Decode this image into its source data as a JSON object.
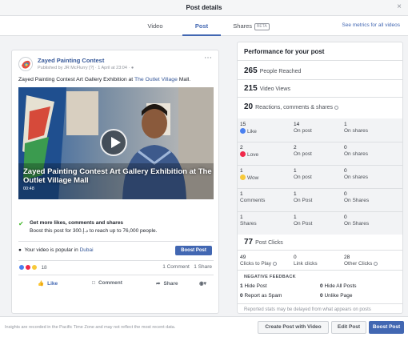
{
  "window": {
    "title": "Post details",
    "close": "×"
  },
  "tabs": [
    {
      "label": "Video"
    },
    {
      "label": "Post"
    },
    {
      "label": "Shares",
      "badge": "BETA"
    }
  ],
  "metrics_link": "See metrics for all videos",
  "post": {
    "page_name": "Zayed Painting Contest",
    "published_by": "Published by JR McFlurry",
    "published_by_badge": "[?]",
    "date": "· 1 April at 23:04 ·",
    "text_before": "Zayed Painting Contest Art Gallery Exhibition at",
    "text_link": "The Outlet Village",
    "text_after": "Mall.",
    "video_caption": "Zayed Painting Contest Art Gallery Exhibition at The Outlet Village Mall",
    "video_time": "00:48",
    "boost_title": "Get more likes, comments and shares",
    "boost_desc": "Boost this post for 300.د.إ to reach up to 76,000 people.",
    "popular_text": "Your video is popular in",
    "popular_link": "Dubai",
    "boost_button": "Boost Post",
    "reaction_count": "18",
    "comments_count": "1 Comment",
    "shares_count": "1 Share",
    "actions": {
      "like": "Like",
      "comment": "Comment",
      "share": "Share"
    }
  },
  "performance": {
    "title": "Performance for your post",
    "people_reached": {
      "value": "265",
      "label": "People Reached"
    },
    "video_views": {
      "value": "215",
      "label": "Video Views"
    },
    "engagement": {
      "value": "20",
      "label": "Reactions, comments & shares"
    },
    "breakdown": [
      {
        "icon": "like",
        "total": "15",
        "label": "Like",
        "on_post": "14",
        "on_post_label": "On post",
        "on_shares": "1",
        "on_shares_label": "On shares"
      },
      {
        "icon": "love",
        "total": "2",
        "label": "Love",
        "on_post": "2",
        "on_post_label": "On post",
        "on_shares": "0",
        "on_shares_label": "On shares"
      },
      {
        "icon": "wow",
        "total": "1",
        "label": "Wow",
        "on_post": "1",
        "on_post_label": "On post",
        "on_shares": "0",
        "on_shares_label": "On shares"
      },
      {
        "icon": "",
        "total": "1",
        "label": "Comments",
        "on_post": "1",
        "on_post_label": "On Post",
        "on_shares": "0",
        "on_shares_label": "On Shares"
      },
      {
        "icon": "",
        "total": "1",
        "label": "Shares",
        "on_post": "1",
        "on_post_label": "On Post",
        "on_shares": "0",
        "on_shares_label": "On Shares"
      }
    ],
    "post_clicks": {
      "value": "77",
      "label": "Post Clicks"
    },
    "click_types": [
      {
        "value": "49",
        "label": "Clicks to Play"
      },
      {
        "value": "0",
        "label": "Link clicks"
      },
      {
        "value": "28",
        "label": "Other Clicks"
      }
    ],
    "negative_title": "NEGATIVE FEEDBACK",
    "negative": [
      {
        "value": "1",
        "label": "Hide Post"
      },
      {
        "value": "0",
        "label": "Hide All Posts"
      },
      {
        "value": "0",
        "label": "Report as Spam"
      },
      {
        "value": "0",
        "label": "Unlike Page"
      }
    ],
    "disclaimer": "Reported stats may be delayed from what appears on posts"
  },
  "footer": {
    "note": "Insights are recorded in the Pacific Time Zone and may not reflect the most recent data.",
    "buttons": {
      "create": "Create Post with Video",
      "edit": "Edit Post",
      "boost": "Boost Post"
    }
  },
  "colors": {
    "brand": "#4267b2",
    "like": "#4a80f0",
    "love": "#f0284a",
    "wow": "#f7c93a",
    "success": "#42b72a"
  }
}
